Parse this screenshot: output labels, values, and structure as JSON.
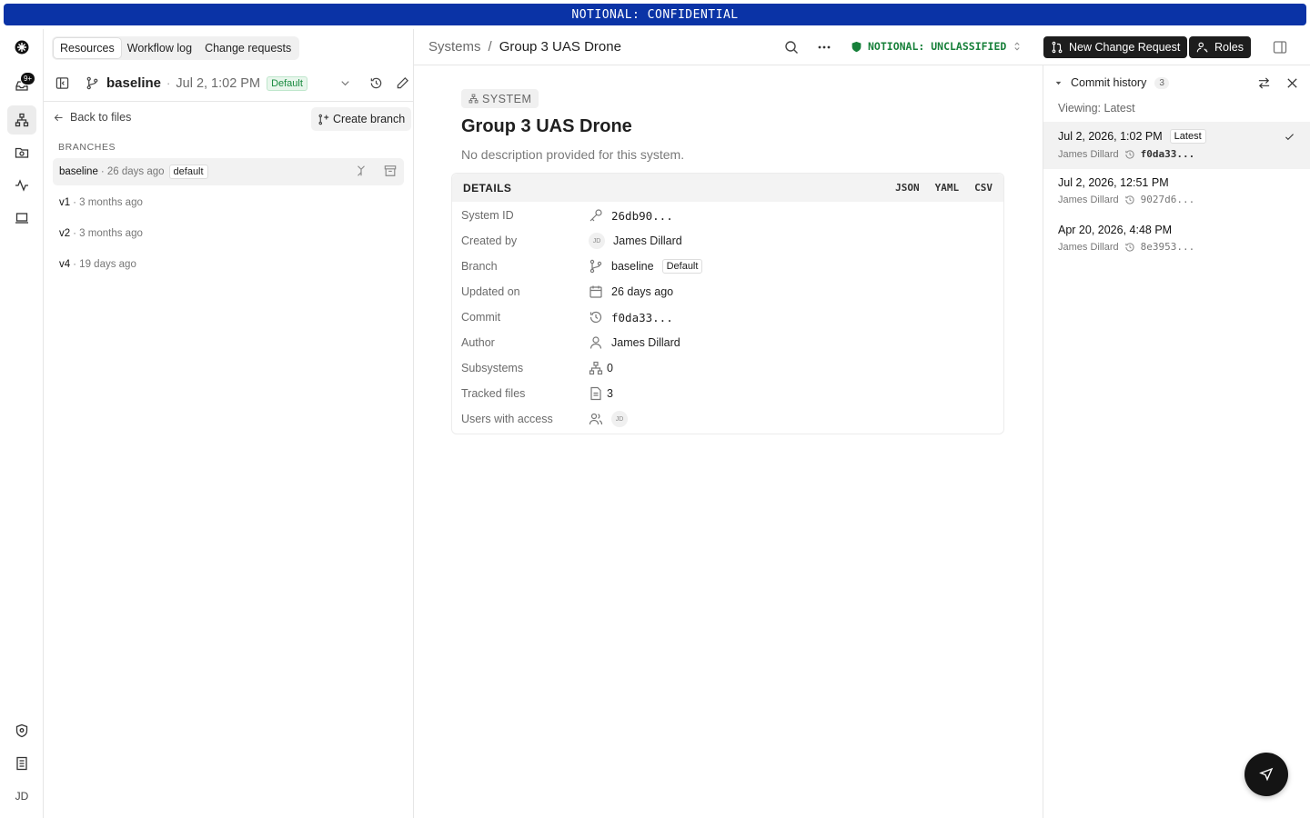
{
  "banner": "NOTIONAL: CONFIDENTIAL",
  "rail": {
    "notif_badge": "9+",
    "avatar": "JD"
  },
  "tabs": [
    "Resources",
    "Workflow log",
    "Change requests"
  ],
  "branchbar": {
    "name": "baseline",
    "date": "Jul 2, 1:02 PM",
    "default_label": "Default"
  },
  "left": {
    "back": "Back to files",
    "create_branch": "Create branch",
    "section": "BRANCHES",
    "branches": [
      {
        "name": "baseline",
        "time": "· 26 days ago",
        "tag": "default"
      },
      {
        "name": "v1",
        "time": "· 3 months ago"
      },
      {
        "name": "v2",
        "time": "· 3 months ago"
      },
      {
        "name": "v4",
        "time": "· 19 days ago"
      }
    ]
  },
  "header": {
    "crumb_root": "Systems",
    "crumb_sep": "/",
    "crumb_current": "Group 3 UAS Drone",
    "classification": "NOTIONAL: UNCLASSIFIED",
    "new_cr": "New Change Request",
    "roles": "Roles"
  },
  "main": {
    "badge": "SYSTEM",
    "title": "Group 3 UAS Drone",
    "description": "No description provided for this system.",
    "details_label": "DETAILS",
    "exports": [
      "JSON",
      "YAML",
      "CSV"
    ],
    "rows": {
      "system_id": {
        "k": "System ID",
        "v": "26db90..."
      },
      "created_by": {
        "k": "Created by",
        "initials": "JD",
        "v": "James Dillard"
      },
      "branch": {
        "k": "Branch",
        "v": "baseline",
        "tag": "Default"
      },
      "updated_on": {
        "k": "Updated on",
        "v": "26 days ago"
      },
      "commit": {
        "k": "Commit",
        "v": "f0da33..."
      },
      "author": {
        "k": "Author",
        "v": "James Dillard"
      },
      "subsystems": {
        "k": "Subsystems",
        "v": "0"
      },
      "tracked_files": {
        "k": "Tracked files",
        "v": "3"
      },
      "users": {
        "k": "Users with access",
        "initials": "JD"
      }
    }
  },
  "history": {
    "title": "Commit history",
    "count": "3",
    "viewing": "Viewing: Latest",
    "commits": [
      {
        "when": "Jul 2, 2026, 1:02 PM",
        "tag": "Latest",
        "author": "James Dillard",
        "hash": "f0da33..."
      },
      {
        "when": "Jul 2, 2026, 12:51 PM",
        "author": "James Dillard",
        "hash": "9027d6..."
      },
      {
        "when": "Apr 20, 2026, 4:48 PM",
        "author": "James Dillard",
        "hash": "8e3953..."
      }
    ]
  },
  "colors": {
    "banner": "#0a33a6",
    "classification": "#17803a",
    "default_pill": "#188a3f"
  }
}
